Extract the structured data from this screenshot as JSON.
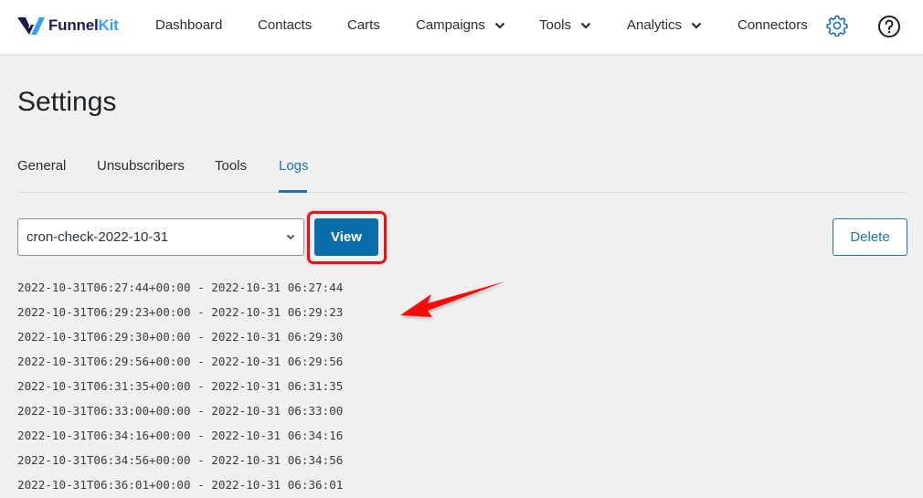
{
  "brand": {
    "name_part1": "Funnel",
    "name_part2": "Kit",
    "primary_color": "#1a1f4a",
    "accent_color": "#3a9ef0"
  },
  "nav": {
    "items": [
      {
        "label": "Dashboard",
        "has_dropdown": false
      },
      {
        "label": "Contacts",
        "has_dropdown": false
      },
      {
        "label": "Carts",
        "has_dropdown": false
      },
      {
        "label": "Campaigns",
        "has_dropdown": true
      },
      {
        "label": "Tools",
        "has_dropdown": true
      },
      {
        "label": "Analytics",
        "has_dropdown": true
      },
      {
        "label": "Connectors",
        "has_dropdown": false
      }
    ],
    "settings_icon": "gear-icon",
    "help_icon": "help-circle-icon"
  },
  "page": {
    "title": "Settings"
  },
  "tabs": [
    {
      "label": "General",
      "active": false
    },
    {
      "label": "Unsubscribers",
      "active": false
    },
    {
      "label": "Tools",
      "active": false
    },
    {
      "label": "Logs",
      "active": true
    }
  ],
  "logs": {
    "selected_file": "cron-check-2022-10-31",
    "view_label": "View",
    "delete_label": "Delete",
    "lines": [
      "2022-10-31T06:27:44+00:00 - 2022-10-31 06:27:44",
      "2022-10-31T06:29:23+00:00 - 2022-10-31 06:29:23",
      "2022-10-31T06:29:30+00:00 - 2022-10-31 06:29:30",
      "2022-10-31T06:29:56+00:00 - 2022-10-31 06:29:56",
      "2022-10-31T06:31:35+00:00 - 2022-10-31 06:31:35",
      "2022-10-31T06:33:00+00:00 - 2022-10-31 06:33:00",
      "2022-10-31T06:34:16+00:00 - 2022-10-31 06:34:16",
      "2022-10-31T06:34:56+00:00 - 2022-10-31 06:34:56",
      "2022-10-31T06:36:01+00:00 - 2022-10-31 06:36:01"
    ]
  },
  "annotations": {
    "highlight_color": "#e3141c",
    "arrow_color": "#f20d0d"
  }
}
